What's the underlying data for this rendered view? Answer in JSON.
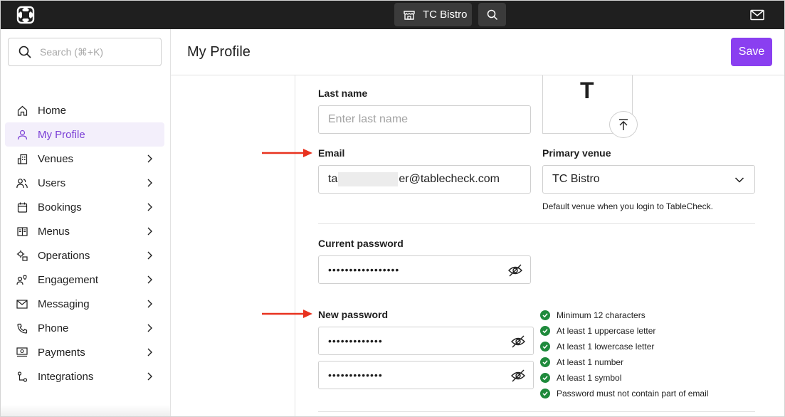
{
  "topbar": {
    "venue_name": "TC Bistro"
  },
  "sidebar": {
    "search_placeholder": "Search (⌘+K)",
    "items": [
      {
        "label": "Home",
        "icon": "home-icon",
        "chevron": false
      },
      {
        "label": "My Profile",
        "icon": "user-icon",
        "chevron": false,
        "active": true
      },
      {
        "label": "Venues",
        "icon": "building-icon",
        "chevron": true
      },
      {
        "label": "Users",
        "icon": "users-icon",
        "chevron": true
      },
      {
        "label": "Bookings",
        "icon": "calendar-icon",
        "chevron": true
      },
      {
        "label": "Menus",
        "icon": "menu-book-icon",
        "chevron": true
      },
      {
        "label": "Operations",
        "icon": "operations-icon",
        "chevron": true
      },
      {
        "label": "Engagement",
        "icon": "engagement-icon",
        "chevron": true
      },
      {
        "label": "Messaging",
        "icon": "envelope-icon",
        "chevron": true
      },
      {
        "label": "Phone",
        "icon": "phone-icon",
        "chevron": true
      },
      {
        "label": "Payments",
        "icon": "payments-icon",
        "chevron": true
      },
      {
        "label": "Integrations",
        "icon": "integrations-icon",
        "chevron": true
      }
    ]
  },
  "header": {
    "title": "My Profile",
    "save_label": "Save"
  },
  "form": {
    "last_name_label": "Last name",
    "last_name_placeholder": "Enter last name",
    "avatar_letter": "T",
    "email_label": "Email",
    "email_prefix": "ta",
    "email_suffix": "er@tablecheck.com",
    "primary_venue_label": "Primary venue",
    "primary_venue_value": "TC Bistro",
    "primary_venue_hint": "Default venue when you login to TableCheck.",
    "current_password_label": "Current password",
    "current_password_value": "•••••••••••••••••",
    "new_password_label": "New password",
    "new_password_value": "•••••••••••••",
    "confirm_password_value": "•••••••••••••"
  },
  "requirements": [
    "Minimum 12 characters",
    "At least 1 uppercase letter",
    "At least 1 lowercase letter",
    "At least 1 number",
    "At least 1 symbol",
    "Password must not contain part of email"
  ],
  "colors": {
    "accent": "#8a3ff0",
    "topbar": "#1f1f1f",
    "success": "#1f8a3c",
    "annotation_arrow": "#e8321f"
  }
}
